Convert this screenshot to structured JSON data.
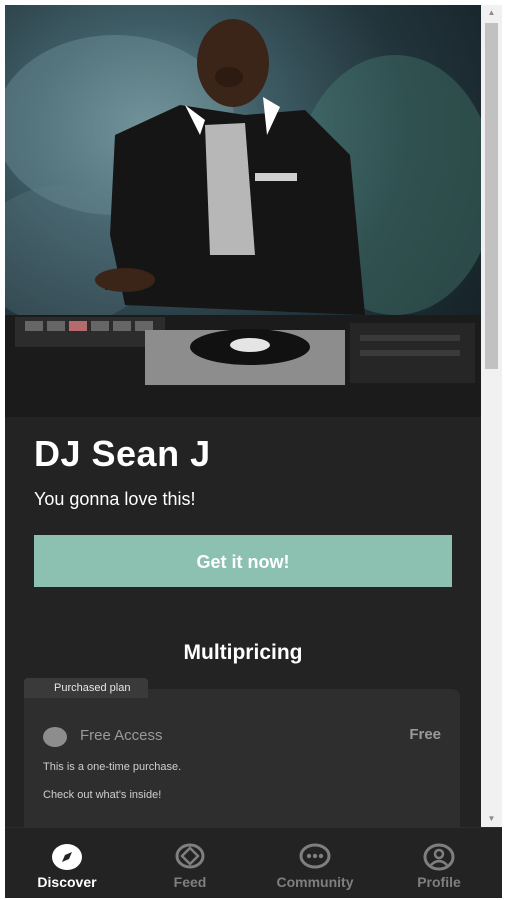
{
  "artist": {
    "name": "DJ Sean J",
    "tagline": "You gonna love this!"
  },
  "cta": {
    "label": "Get it now!",
    "color": "#8cc1b2"
  },
  "pricing": {
    "section_title": "Multipricing",
    "plans": [
      {
        "tag": "Purchased plan",
        "name": "Free Access",
        "price": "Free",
        "description_1": "This is a one-time purchase.",
        "description_2": "Check out what's inside!"
      }
    ]
  },
  "nav": {
    "items": [
      {
        "label": "Discover",
        "icon": "compass-icon",
        "active": true
      },
      {
        "label": "Feed",
        "icon": "feed-icon",
        "active": false
      },
      {
        "label": "Community",
        "icon": "chat-icon",
        "active": false
      },
      {
        "label": "Profile",
        "icon": "user-icon",
        "active": false
      }
    ]
  },
  "colors": {
    "background": "#232323",
    "card": "#2e2e2e",
    "accent": "#8cc1b2"
  }
}
